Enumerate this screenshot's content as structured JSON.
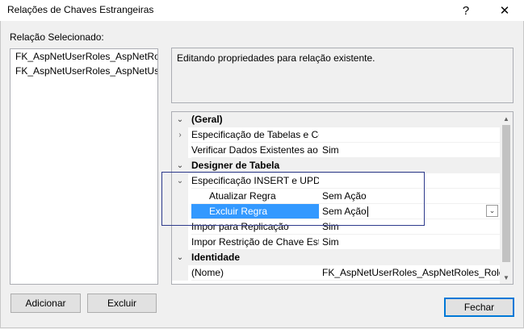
{
  "window": {
    "title": "Relações de Chaves Estrangeiras",
    "help_glyph": "?",
    "close_glyph": "✕"
  },
  "relations": {
    "label": "Relação Selecionado:",
    "items": [
      "FK_AspNetUserRoles_AspNetRoles_RoleId",
      "FK_AspNetUserRoles_AspNetUsers_UserId"
    ]
  },
  "description": "Editando propriedades para relação existente.",
  "grid": {
    "rows": [
      {
        "kind": "cat",
        "expander": "⌄",
        "name": "(Geral)",
        "value": ""
      },
      {
        "kind": "prop",
        "expander": "›",
        "name": "Especificação de Tabelas e Colunas",
        "value": ""
      },
      {
        "kind": "prop",
        "expander": "",
        "name": "Verificar Dados Existentes ao Criar ou Reabilitar",
        "value": "Sim"
      },
      {
        "kind": "cat",
        "expander": "⌄",
        "name": "Designer de Tabela",
        "value": ""
      },
      {
        "kind": "prop",
        "expander": "⌄",
        "name": "Especificação INSERT e UPDATE",
        "value": ""
      },
      {
        "kind": "sub",
        "expander": "",
        "name": "Atualizar Regra",
        "value": "Sem Ação"
      },
      {
        "kind": "sub",
        "expander": "",
        "name": "Excluir Regra",
        "value": "Sem Ação",
        "selected": true
      },
      {
        "kind": "prop",
        "expander": "",
        "name": "Impor para Replicação",
        "value": "Sim"
      },
      {
        "kind": "prop",
        "expander": "",
        "name": "Impor Restrição de Chave Estrangeira",
        "value": "Sim"
      },
      {
        "kind": "cat",
        "expander": "⌄",
        "name": "Identidade",
        "value": ""
      },
      {
        "kind": "prop",
        "expander": "",
        "name": "(Nome)",
        "value": "FK_AspNetUserRoles_AspNetRoles_RoleId"
      }
    ]
  },
  "buttons": {
    "add": "Adicionar",
    "delete": "Excluir",
    "close": "Fechar"
  },
  "colors": {
    "selection": "#3399ff",
    "focus_border": "#2d3a8c",
    "default_button_border": "#0078d7"
  }
}
